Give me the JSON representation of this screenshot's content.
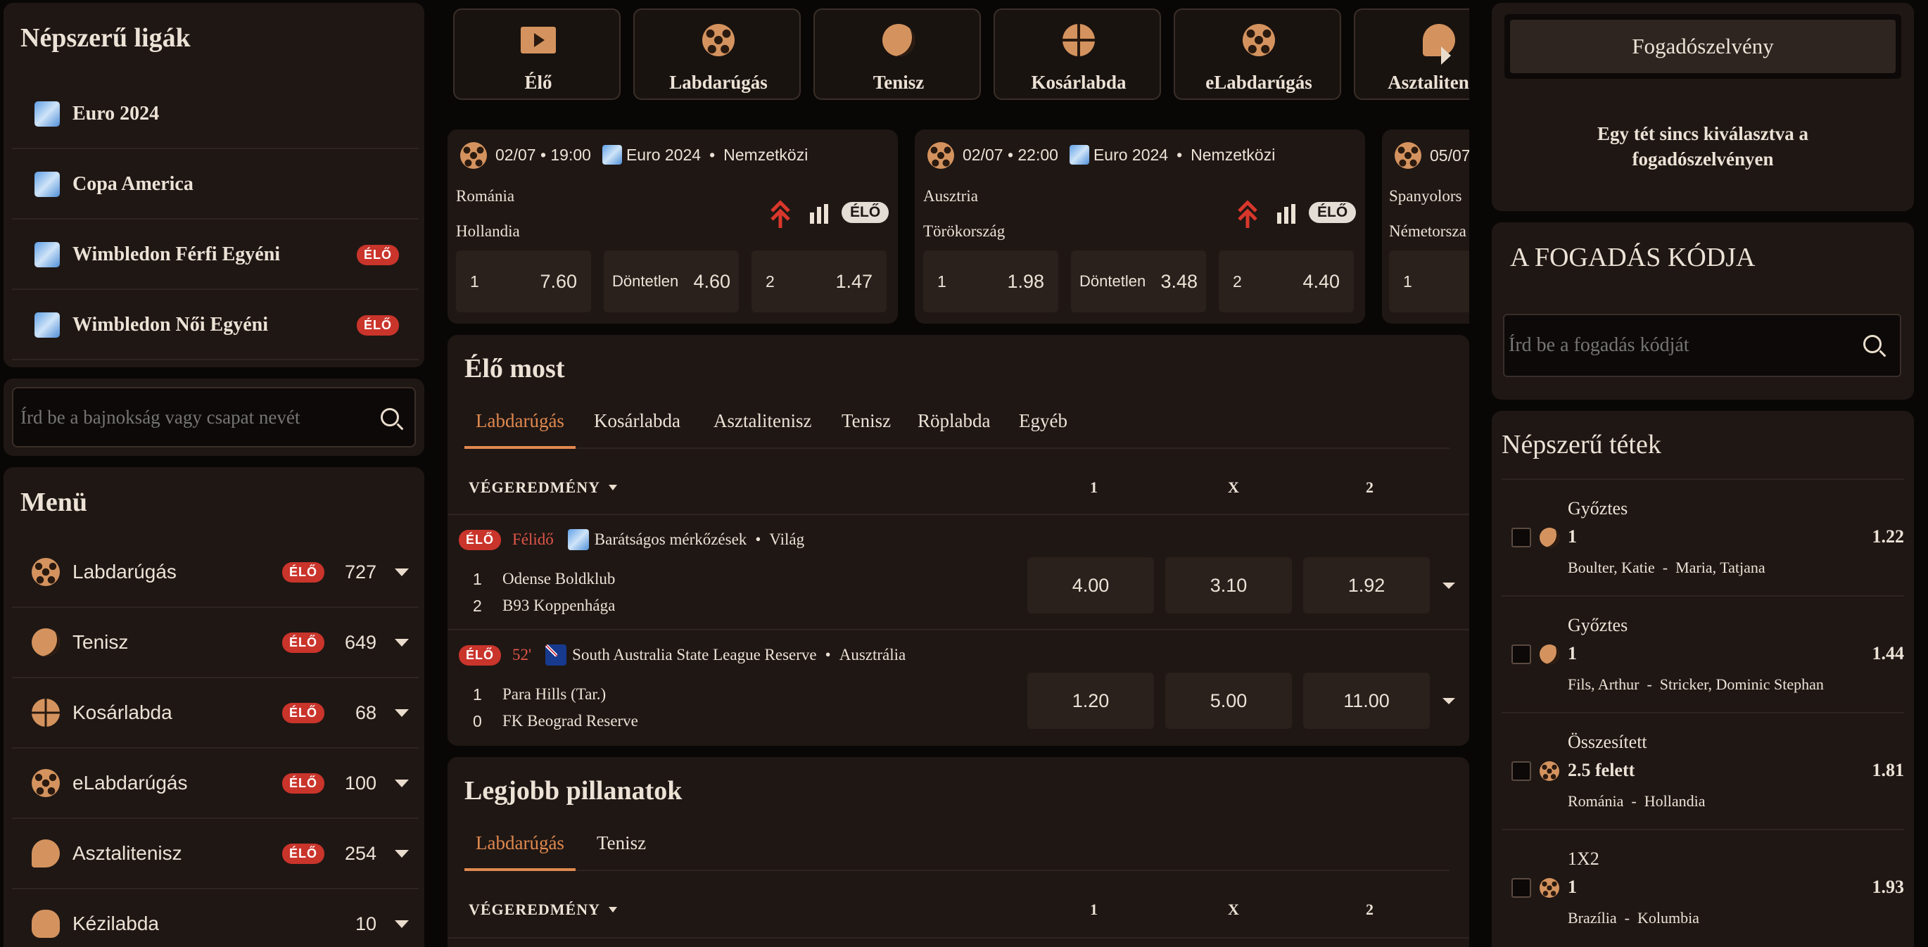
{
  "popular_leagues": {
    "title": "Népszerű ligák",
    "items": [
      {
        "label": "Euro 2024",
        "live": ""
      },
      {
        "label": "Copa America",
        "live": ""
      },
      {
        "label": "Wimbledon Férfi Egyéni",
        "live": "ÉLŐ"
      },
      {
        "label": "Wimbledon Női Egyéni",
        "live": "ÉLŐ"
      }
    ]
  },
  "league_search": {
    "placeholder": "Írd be a bajnokság vagy csapat nevét"
  },
  "menu": {
    "title": "Menü",
    "items": [
      {
        "label": "Labdarúgás",
        "live": "ÉLŐ",
        "count": "727",
        "icon": "soccer-ball-icon"
      },
      {
        "label": "Tenisz",
        "live": "ÉLŐ",
        "count": "649",
        "icon": "tennis-ball-icon"
      },
      {
        "label": "Kosárlabda",
        "live": "ÉLŐ",
        "count": "68",
        "icon": "basketball-icon"
      },
      {
        "label": "eLabdarúgás",
        "live": "ÉLŐ",
        "count": "100",
        "icon": "esoccer-ball-icon"
      },
      {
        "label": "Asztalitenisz",
        "live": "ÉLŐ",
        "count": "254",
        "icon": "table-tennis-icon"
      },
      {
        "label": "Kézilabda",
        "live": "",
        "count": "10",
        "icon": "handball-icon"
      }
    ]
  },
  "sport_tabs": [
    {
      "label": "Élő",
      "icon": "play-icon"
    },
    {
      "label": "Labdarúgás",
      "icon": "soccer-ball-icon"
    },
    {
      "label": "Tenisz",
      "icon": "tennis-ball-icon"
    },
    {
      "label": "Kosárlabda",
      "icon": "basketball-icon"
    },
    {
      "label": "eLabdarúgás",
      "icon": "esoccer-ball-icon"
    },
    {
      "label": "Asztalitenisz",
      "icon": "table-tennis-icon"
    }
  ],
  "featured": [
    {
      "datetime": "02/07 • 19:00",
      "league": "Euro 2024",
      "sep": "•",
      "region": "Nemzetközi",
      "home": "Románia",
      "away": "Hollandia",
      "live_tag": "ÉLŐ",
      "odds": [
        {
          "label": "1",
          "value": "7.60"
        },
        {
          "label": "Döntetlen",
          "value": "4.60"
        },
        {
          "label": "2",
          "value": "1.47"
        }
      ]
    },
    {
      "datetime": "02/07 • 22:00",
      "league": "Euro 2024",
      "sep": "•",
      "region": "Nemzetközi",
      "home": "Ausztria",
      "away": "Törökország",
      "live_tag": "ÉLŐ",
      "odds": [
        {
          "label": "1",
          "value": "1.98"
        },
        {
          "label": "Döntetlen",
          "value": "3.48"
        },
        {
          "label": "2",
          "value": "4.40"
        }
      ]
    },
    {
      "datetime": "05/07",
      "home": "Spanyolors",
      "away": "Németorsza",
      "odds_label": "1"
    }
  ],
  "live_now": {
    "title": "Élő most",
    "tabs": [
      "Labdarúgás",
      "Kosárlabda",
      "Asztalitenisz",
      "Tenisz",
      "Röplabda",
      "Egyéb"
    ],
    "market": "VÉGEREDMÉNY",
    "cols": [
      "1",
      "X",
      "2"
    ],
    "matches": [
      {
        "live": "ÉLŐ",
        "status": "Félidő",
        "league": "Barátságos mérkőzések",
        "sep": "•",
        "region": "Világ",
        "home_score": "1",
        "home": "Odense Boldklub",
        "away_score": "2",
        "away": "B93 Koppenhága",
        "odds": [
          "4.00",
          "3.10",
          "1.92"
        ]
      },
      {
        "live": "ÉLŐ",
        "status": "52'",
        "league": "South Australia State League Reserve",
        "sep": "•",
        "region": "Ausztrália",
        "home_score": "1",
        "home": "Para Hills (Tar.)",
        "away_score": "0",
        "away": "FK Beograd Reserve",
        "odds": [
          "1.20",
          "5.00",
          "11.00"
        ]
      }
    ]
  },
  "highlights": {
    "title": "Legjobb pillanatok",
    "tabs": [
      "Labdarúgás",
      "Tenisz"
    ],
    "market": "VÉGEREDMÉNY",
    "cols": [
      "1",
      "X",
      "2"
    ]
  },
  "betslip": {
    "title": "Fogadószelvény",
    "empty": "Egy tét sincs kiválasztva a fogadószelvényen"
  },
  "bet_code": {
    "title": "A FOGADÁS KÓDJA",
    "placeholder": "Írd be a fogadás kódját"
  },
  "popular_bets": {
    "title": "Népszerű tétek",
    "items": [
      {
        "market": "Győztes",
        "pick": "1",
        "odd": "1.22",
        "event": "Boulter, Katie  -  Maria, Tatjana",
        "icon": "tennis-ball-icon"
      },
      {
        "market": "Győztes",
        "pick": "1",
        "odd": "1.44",
        "event": "Fils, Arthur  -  Stricker, Dominic Stephan",
        "icon": "tennis-ball-icon"
      },
      {
        "market": "Összesített",
        "pick": "2.5 felett",
        "odd": "1.81",
        "event": "Románia  -  Hollandia",
        "icon": "soccer-ball-icon"
      },
      {
        "market": "1X2",
        "pick": "1",
        "odd": "1.93",
        "event": "Brazília  -  Kolumbia",
        "icon": "soccer-ball-icon"
      }
    ]
  },
  "colors": {
    "accent": "#e0894f",
    "live_red": "#c9342b",
    "panel": "#1f1714",
    "background": "#090706"
  }
}
